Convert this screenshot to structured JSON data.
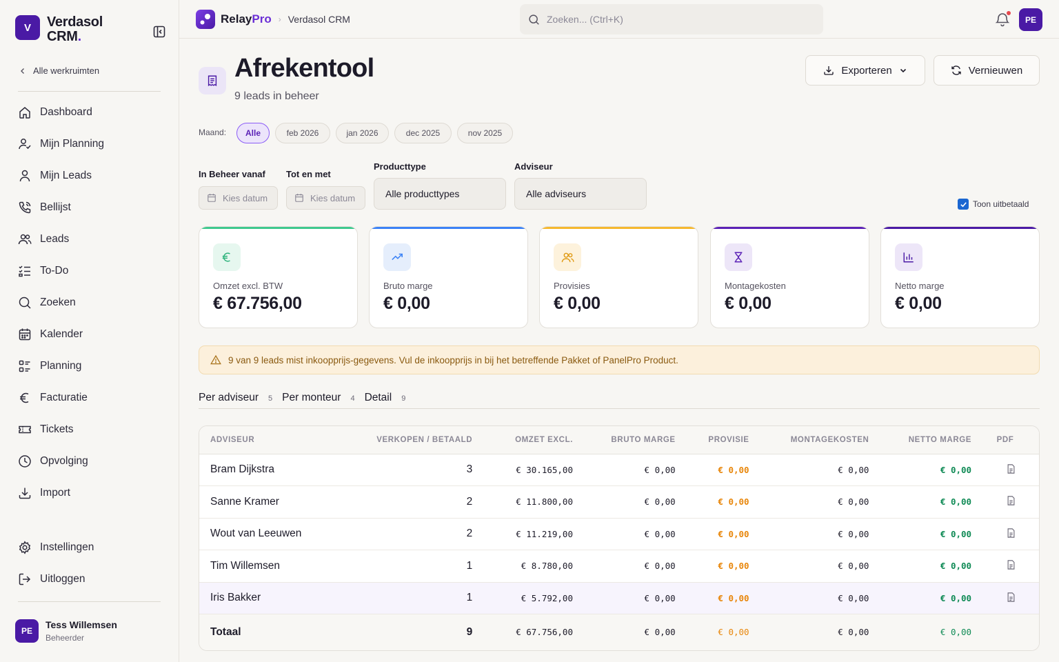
{
  "sidebar": {
    "brand_initial": "V",
    "brand_name": "Verdasol",
    "brand_name2": "CRM",
    "brand_dot": ".",
    "back_label": "Alle werkruimten",
    "nav": [
      {
        "label": "Dashboard",
        "icon": "home-icon"
      },
      {
        "label": "Mijn Planning",
        "icon": "user-check-icon"
      },
      {
        "label": "Mijn Leads",
        "icon": "user-icon"
      },
      {
        "label": "Bellijst",
        "icon": "phone-icon"
      },
      {
        "label": "Leads",
        "icon": "users-icon"
      },
      {
        "label": "To-Do",
        "icon": "list-check-icon"
      },
      {
        "label": "Zoeken",
        "icon": "search-icon"
      },
      {
        "label": "Kalender",
        "icon": "calendar-icon"
      },
      {
        "label": "Planning",
        "icon": "planning-icon"
      },
      {
        "label": "Facturatie",
        "icon": "euro-icon"
      },
      {
        "label": "Tickets",
        "icon": "ticket-icon"
      },
      {
        "label": "Opvolging",
        "icon": "clock-icon"
      },
      {
        "label": "Import",
        "icon": "download-icon"
      }
    ],
    "bottom_nav": [
      {
        "label": "Instellingen",
        "icon": "gear-icon"
      },
      {
        "label": "Uitloggen",
        "icon": "logout-icon"
      }
    ],
    "user": {
      "initials": "PE",
      "name": "Tess Willemsen",
      "role": "Beheerder"
    }
  },
  "topbar": {
    "logo_relay": "Relay",
    "logo_pro": "Pro",
    "breadcrumb": "Verdasol CRM",
    "search_placeholder": "Zoeken... (Ctrl+K)",
    "avatar": "PE"
  },
  "header": {
    "title": "Afrekentool",
    "subtitle": "9 leads in beheer",
    "export_label": "Exporteren",
    "refresh_label": "Vernieuwen"
  },
  "months": {
    "label": "Maand:",
    "options": [
      "Alle",
      "feb 2026",
      "jan 2026",
      "dec 2025",
      "nov 2025"
    ],
    "selected": "Alle"
  },
  "filters": {
    "from_label": "In Beheer vanaf",
    "from_placeholder": "Kies datum",
    "to_label": "Tot en met",
    "to_placeholder": "Kies datum",
    "product_label": "Producttype",
    "product_value": "Alle producttypes",
    "advisor_label": "Adviseur",
    "advisor_value": "Alle adviseurs",
    "show_paid_label": "Toon uitbetaald",
    "show_paid": true
  },
  "kpis": [
    {
      "label": "Omzet excl. BTW",
      "value": "€ 67.756,00",
      "icon": "euro-icon",
      "color": "#3ec98e",
      "bg": "#e6f7ef",
      "fg": "#2bb27a"
    },
    {
      "label": "Bruto marge",
      "value": "€ 0,00",
      "icon": "trending-up-icon",
      "color": "#3b82f6",
      "bg": "#e5eefc",
      "fg": "#3b82f6"
    },
    {
      "label": "Provisies",
      "value": "€ 0,00",
      "icon": "users-icon",
      "color": "#f5b82e",
      "bg": "#fdf2dc",
      "fg": "#e09a12"
    },
    {
      "label": "Montagekosten",
      "value": "€ 0,00",
      "icon": "hourglass-icon",
      "color": "#5b21b6",
      "bg": "#ede6f8",
      "fg": "#5b21b6"
    },
    {
      "label": "Netto marge",
      "value": "€ 0,00",
      "icon": "bar-chart-icon",
      "color": "#4a1aa5",
      "bg": "#ede6f8",
      "fg": "#4a1aa5"
    }
  ],
  "alert": "9 van 9 leads mist inkoopprijs-gegevens. Vul de inkoopprijs in bij het betreffende Pakket of PanelPro Product.",
  "tabs": [
    {
      "label": "Per adviseur",
      "count": "5"
    },
    {
      "label": "Per monteur",
      "count": "4"
    },
    {
      "label": "Detail",
      "count": "9"
    }
  ],
  "table": {
    "headers": [
      "Adviseur",
      "Verkopen / Betaald",
      "Omzet excl.",
      "Bruto marge",
      "Provisie",
      "Montagekosten",
      "Netto marge",
      "PDF"
    ],
    "rows": [
      {
        "name": "Bram Dijkstra",
        "sales": "3",
        "revenue": "€ 30.165,00",
        "gross": "€ 0,00",
        "commission": "€ 0,00",
        "install": "€ 0,00",
        "net": "€ 0,00"
      },
      {
        "name": "Sanne Kramer",
        "sales": "2",
        "revenue": "€ 11.800,00",
        "gross": "€ 0,00",
        "commission": "€ 0,00",
        "install": "€ 0,00",
        "net": "€ 0,00"
      },
      {
        "name": "Wout van Leeuwen",
        "sales": "2",
        "revenue": "€ 11.219,00",
        "gross": "€ 0,00",
        "commission": "€ 0,00",
        "install": "€ 0,00",
        "net": "€ 0,00"
      },
      {
        "name": "Tim Willemsen",
        "sales": "1",
        "revenue": "€ 8.780,00",
        "gross": "€ 0,00",
        "commission": "€ 0,00",
        "install": "€ 0,00",
        "net": "€ 0,00"
      },
      {
        "name": "Iris Bakker",
        "sales": "1",
        "revenue": "€ 5.792,00",
        "gross": "€ 0,00",
        "commission": "€ 0,00",
        "install": "€ 0,00",
        "net": "€ 0,00"
      }
    ],
    "total": {
      "name": "Totaal",
      "sales": "9",
      "revenue": "€ 67.756,00",
      "gross": "€ 0,00",
      "commission": "€ 0,00",
      "install": "€ 0,00",
      "net": "€ 0,00"
    }
  }
}
